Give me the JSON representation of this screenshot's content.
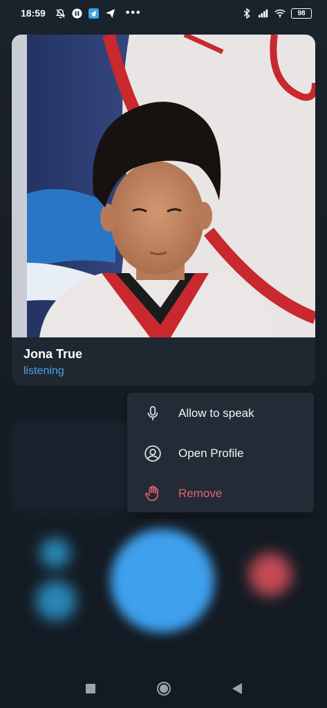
{
  "status_bar": {
    "time": "18:59",
    "battery": "98",
    "left_icons": [
      "mute-icon",
      "podcast-icon",
      "telegram-icon",
      "send-icon"
    ],
    "right_icons": [
      "bluetooth-icon",
      "signal-icon",
      "wifi-icon"
    ]
  },
  "participant": {
    "name": "Jona True",
    "status": "listening",
    "status_color": "#4ea7e9"
  },
  "context_menu": {
    "items": [
      {
        "label": "Allow to speak",
        "icon": "microphone-icon"
      },
      {
        "label": "Open Profile",
        "icon": "profile-icon"
      },
      {
        "label": "Remove",
        "icon": "hand-icon",
        "color": "#e5636a"
      }
    ]
  },
  "navigation": {
    "buttons": [
      "recents-button",
      "home-button",
      "back-button"
    ]
  }
}
